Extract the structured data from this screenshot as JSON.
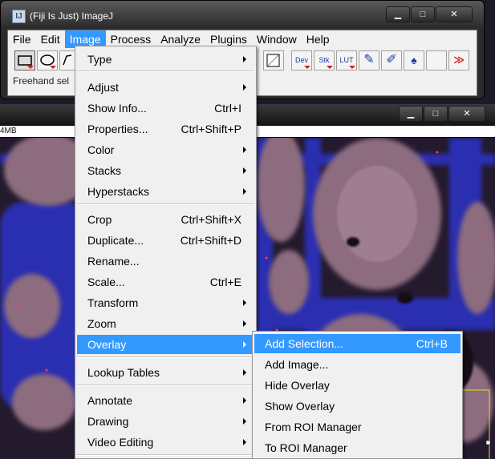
{
  "main_window": {
    "title": "(Fiji Is Just) ImageJ",
    "icon_text": "IJ",
    "status": "Freehand sel"
  },
  "image_window": {
    "info": "4MB"
  },
  "window_controls": {
    "minimize": "▁",
    "maximize": "□",
    "close": "✕"
  },
  "menubar": [
    {
      "label": "File"
    },
    {
      "label": "Edit"
    },
    {
      "label": "Image"
    },
    {
      "label": "Process"
    },
    {
      "label": "Analyze"
    },
    {
      "label": "Plugins"
    },
    {
      "label": "Window"
    },
    {
      "label": "Help"
    }
  ],
  "toolbar": {
    "tools": [
      "rectangle-tool",
      "oval-tool",
      "polygon-tool",
      "line-tool"
    ],
    "right_tools": [
      {
        "name": "dev-menu",
        "label": "Dev"
      },
      {
        "name": "stk-menu",
        "label": "Stk"
      },
      {
        "name": "lut-menu",
        "label": "LUT"
      },
      {
        "name": "pencil-tool",
        "label": "✎"
      },
      {
        "name": "brush-tool",
        "label": "✐"
      },
      {
        "name": "flood-fill-tool",
        "label": "♠"
      },
      {
        "name": "more-tools",
        "label": "≫"
      }
    ]
  },
  "image_menu": {
    "items": [
      {
        "label": "Type",
        "shortcut": "",
        "submenu": true
      },
      {
        "label": "Adjust",
        "shortcut": "",
        "submenu": true
      },
      {
        "label": "Show Info...",
        "shortcut": "Ctrl+I",
        "submenu": false
      },
      {
        "label": "Properties...",
        "shortcut": "Ctrl+Shift+P",
        "submenu": false
      },
      {
        "label": "Color",
        "shortcut": "",
        "submenu": true
      },
      {
        "label": "Stacks",
        "shortcut": "",
        "submenu": true
      },
      {
        "label": "Hyperstacks",
        "shortcut": "",
        "submenu": true
      },
      {
        "label": "Crop",
        "shortcut": "Ctrl+Shift+X",
        "submenu": false
      },
      {
        "label": "Duplicate...",
        "shortcut": "Ctrl+Shift+D",
        "submenu": false
      },
      {
        "label": "Rename...",
        "shortcut": "",
        "submenu": false
      },
      {
        "label": "Scale...",
        "shortcut": "Ctrl+E",
        "submenu": false
      },
      {
        "label": "Transform",
        "shortcut": "",
        "submenu": true
      },
      {
        "label": "Zoom",
        "shortcut": "",
        "submenu": true
      },
      {
        "label": "Overlay",
        "shortcut": "",
        "submenu": true
      },
      {
        "label": "Lookup Tables",
        "shortcut": "",
        "submenu": true
      },
      {
        "label": "Annotate",
        "shortcut": "",
        "submenu": true
      },
      {
        "label": "Drawing",
        "shortcut": "",
        "submenu": true
      },
      {
        "label": "Video Editing",
        "shortcut": "",
        "submenu": true
      }
    ]
  },
  "overlay_menu": {
    "items": [
      {
        "label": "Add Selection...",
        "shortcut": "Ctrl+B"
      },
      {
        "label": "Add Image...",
        "shortcut": ""
      },
      {
        "label": "Hide Overlay",
        "shortcut": ""
      },
      {
        "label": "Show Overlay",
        "shortcut": ""
      },
      {
        "label": "From ROI Manager",
        "shortcut": ""
      },
      {
        "label": "To ROI Manager",
        "shortcut": ""
      }
    ]
  },
  "colors": {
    "highlight": "#3399ff",
    "menu_bg": "#f0f0f0"
  }
}
